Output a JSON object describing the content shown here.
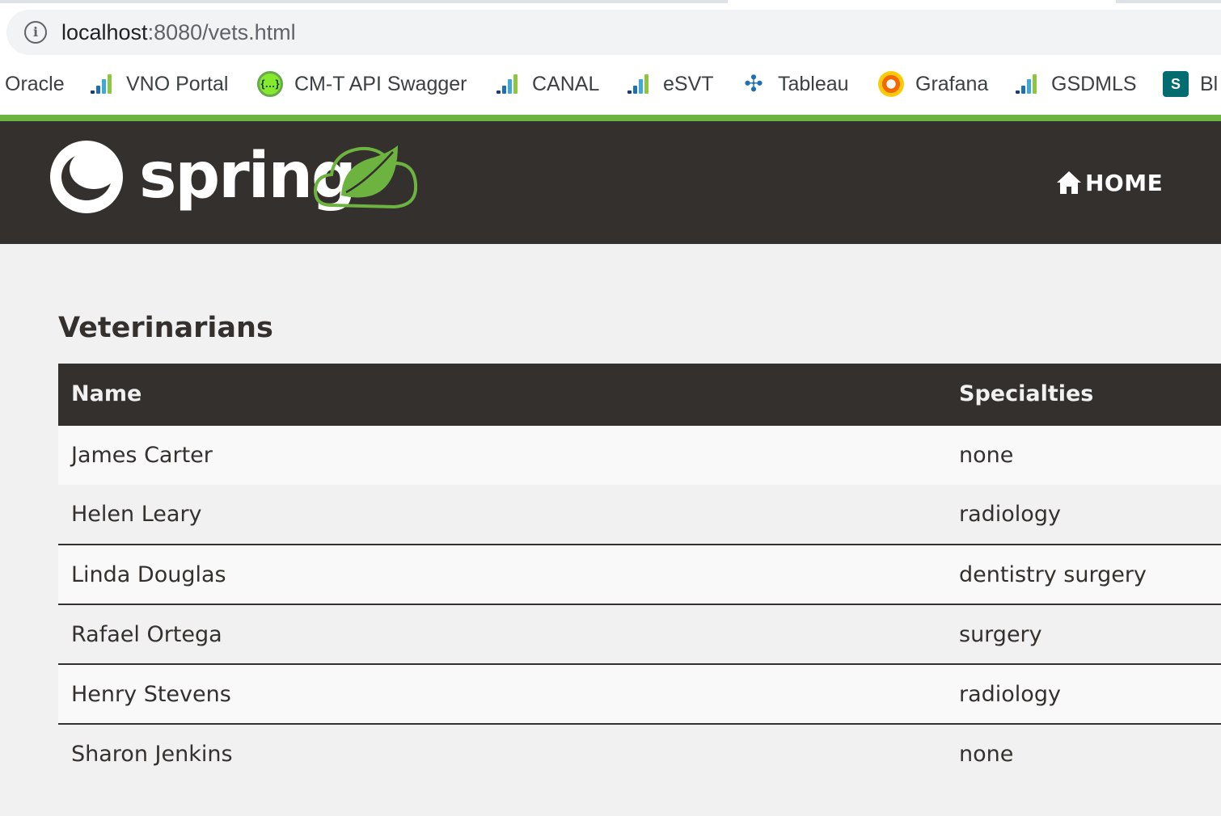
{
  "browser": {
    "url_host": "localhost",
    "url_rest": ":8080/vets.html",
    "bookmarks": [
      {
        "label": "Oracle",
        "icon": "none"
      },
      {
        "label": "VNO Portal",
        "icon": "bars-chart-icon"
      },
      {
        "label": "CM-T API Swagger",
        "icon": "swagger-icon"
      },
      {
        "label": "CANAL",
        "icon": "bars-chart-icon"
      },
      {
        "label": "eSVT",
        "icon": "bars-chart-icon"
      },
      {
        "label": "Tableau",
        "icon": "tableau-icon"
      },
      {
        "label": "Grafana",
        "icon": "grafana-icon"
      },
      {
        "label": "GSDMLS",
        "icon": "bars-chart-icon"
      },
      {
        "label": "Bl",
        "icon": "sharepoint-icon"
      }
    ]
  },
  "navbar": {
    "brand": "spring",
    "home_label": "HOME"
  },
  "page": {
    "title": "Veterinarians",
    "columns": [
      "Name",
      "Specialties"
    ],
    "rows": [
      {
        "name": "James Carter",
        "specialties": "none"
      },
      {
        "name": "Helen Leary",
        "specialties": "radiology"
      },
      {
        "name": "Linda Douglas",
        "specialties": "dentistry surgery"
      },
      {
        "name": "Rafael Ortega",
        "specialties": "surgery"
      },
      {
        "name": "Henry Stevens",
        "specialties": "radiology"
      },
      {
        "name": "Sharon Jenkins",
        "specialties": "none"
      }
    ]
  },
  "colors": {
    "brand_green": "#6db33f",
    "navbar_bg": "#34302d",
    "page_bg": "#f1f1f1"
  }
}
